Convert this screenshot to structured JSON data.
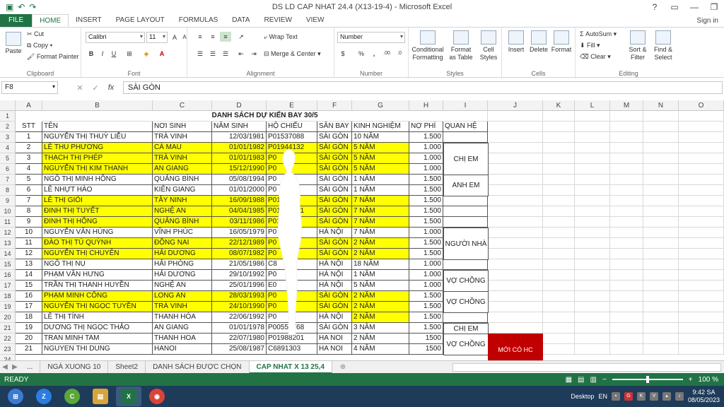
{
  "window": {
    "title": "DS LD CAP NHAT  24.4 (X13-19-4) - Microsoft Excel"
  },
  "ribbon_tabs": [
    "FILE",
    "HOME",
    "INSERT",
    "PAGE LAYOUT",
    "FORMULAS",
    "DATA",
    "REVIEW",
    "VIEW"
  ],
  "signin": "Sign in",
  "clipboard": {
    "paste": "Paste",
    "cut": "Cut",
    "copy": "Copy",
    "format_painter": "Format Painter",
    "label": "Clipboard"
  },
  "font": {
    "name": "Calibri",
    "size": "11",
    "label": "Font"
  },
  "alignment": {
    "wrap": "Wrap Text",
    "merge": "Merge & Center",
    "label": "Alignment"
  },
  "number": {
    "format": "Number",
    "label": "Number"
  },
  "styles": {
    "conditional": "Conditional Formatting",
    "format_table": "Format as Table",
    "cell_styles": "Cell Styles",
    "label": "Styles"
  },
  "cells": {
    "insert": "Insert",
    "delete": "Delete",
    "format": "Format",
    "label": "Cells"
  },
  "editing": {
    "autosum": "AutoSum",
    "fill": "Fill",
    "clear": "Clear",
    "sort": "Sort & Filter",
    "find": "Find & Select",
    "label": "Editing"
  },
  "formula_bar": {
    "name_box": "F8",
    "fx": "fx",
    "value": "SÀI GÒN"
  },
  "columns": [
    "A",
    "B",
    "C",
    "D",
    "E",
    "F",
    "G",
    "H",
    "I",
    "J",
    "K",
    "L",
    "M",
    "N",
    "O"
  ],
  "sheet": {
    "title": "DANH SÁCH DỰ KIẾN BAY 30/5",
    "headers": [
      "STT",
      "TÊN",
      "NƠI SINH",
      "NĂM SINH",
      "HỘ CHIẾU",
      "SÂN BAY",
      "KINH NGHIỆM",
      "NỢ PHÍ",
      "QUAN HỆ"
    ],
    "rows": [
      {
        "n": "3",
        "stt": "1",
        "ten": "NGUYỄN THỊ THUỲ LIỄU",
        "noi": "TRÀ VINH",
        "nam": "12/03/1981",
        "hc": "P01537088",
        "sb": "SÀI GÒN",
        "kn": "10 NĂM",
        "phi": "1.500",
        "y": false
      },
      {
        "n": "4",
        "stt": "2",
        "ten": "LÊ THU PHƯƠNG",
        "noi": "CÀ MAU",
        "nam": "01/01/1982",
        "hc": "P01944132",
        "sb": "SÀI GÒN",
        "kn": "5 NĂM",
        "phi": "1.000",
        "y": true
      },
      {
        "n": "5",
        "stt": "3",
        "ten": "THẠCH THỊ PHÉP",
        "noi": "TRÀ VINH",
        "nam": "01/01/1983",
        "hc": "P0",
        "sb": "SÀI GÒN",
        "kn": "5 NĂM",
        "phi": "1.000",
        "y": true
      },
      {
        "n": "6",
        "stt": "4",
        "ten": "NGUYỄN THỊ KIM THANH",
        "noi": "AN GIANG",
        "nam": "15/12/1990",
        "hc": "P0",
        "sb": "SÀI GÒN",
        "kn": "5 NĂM",
        "phi": "1.000",
        "y": true
      },
      {
        "n": "7",
        "stt": "5",
        "ten": "NGÔ THỊ MINH HỒNG",
        "noi": "QUẢNG BÌNH",
        "nam": "05/08/1994",
        "hc": "P0",
        "sb": "SÀI GÒN",
        "kn": "1 NĂM",
        "phi": "1.500",
        "y": false
      },
      {
        "n": "8",
        "stt": "6",
        "ten": "LÊ NHỰT HÀO",
        "noi": "KIÊN GIANG",
        "nam": "01/01/2000",
        "hc": "P0",
        "sb": "SÀI GÒN",
        "kn": "1 NĂM",
        "phi": "1.500",
        "y": false
      },
      {
        "n": "9",
        "stt": "7",
        "ten": "LÊ THỊ GIỎI",
        "noi": "TÂY NINH",
        "nam": "16/09/1988",
        "hc": "P01",
        "sb": "SÀI GÒN",
        "kn": "7 NĂM",
        "phi": "1.500",
        "y": true
      },
      {
        "n": "10",
        "stt": "8",
        "ten": "ĐINH THỊ TUYẾT",
        "noi": "NGHỆ AN",
        "nam": "04/04/1985",
        "hc": "P01944161",
        "sb": "SÀI GÒN",
        "kn": "7 NĂM",
        "phi": "1.500",
        "y": true
      },
      {
        "n": "11",
        "stt": "9",
        "ten": "ĐINH THỊ HỒNG",
        "noi": "QUẢNG BÌNH",
        "nam": "03/11/1986",
        "hc": "P01",
        "sb": "SÀI GÒN",
        "kn": "7 NĂM",
        "phi": "1.500",
        "y": true
      },
      {
        "n": "12",
        "stt": "10",
        "ten": "NGUYỄN VĂN HÙNG",
        "noi": "VĨNH PHÚC",
        "nam": "16/05/1979",
        "hc": "P0",
        "sb": "HÀ NỘI",
        "kn": "7 NĂM",
        "phi": "1.000",
        "y": false
      },
      {
        "n": "13",
        "stt": "11",
        "ten": "ĐÀO THỊ TÚ QUỲNH",
        "noi": "ĐỒNG NAI",
        "nam": "22/12/1989",
        "hc": "P0",
        "sb": "SÀI GÒN",
        "kn": "2 NĂM",
        "phi": "1.500",
        "y": true
      },
      {
        "n": "14",
        "stt": "12",
        "ten": "NGUYỄN THỊ CHUYÊN",
        "noi": "HẢI DƯƠNG",
        "nam": "08/07/1982",
        "hc": "P0",
        "sb": "SÀI GÒN",
        "kn": "2 NĂM",
        "phi": "1.500",
        "y": true
      },
      {
        "n": "15",
        "stt": "13",
        "ten": "NGÔ THỊ NỤ",
        "noi": "HẢI PHÒNG",
        "nam": "21/05/1986",
        "hc": "C8",
        "sb": "HÀ NỘI",
        "kn": "18 NĂM",
        "phi": "1.000",
        "y": false
      },
      {
        "n": "16",
        "stt": "14",
        "ten": "PHẠM VĂN HƯNG",
        "noi": "HẢI DƯƠNG",
        "nam": "29/10/1992",
        "hc": "P0",
        "sb": "HÀ NỘI",
        "kn": "1 NĂM",
        "phi": "1.000",
        "y": false
      },
      {
        "n": "17",
        "stt": "15",
        "ten": "TRẦN THỊ THANH HUYỀN",
        "noi": "NGHỆ AN",
        "nam": "25/01/1996",
        "hc": "E0",
        "sb": "HÀ NỘI",
        "kn": "5 NĂM",
        "phi": "1.000",
        "y": false
      },
      {
        "n": "18",
        "stt": "16",
        "ten": "PHẠM MINH CÔNG",
        "noi": "LONG AN",
        "nam": "28/03/1993",
        "hc": "P0",
        "sb": "SÀI GÒN",
        "kn": "2 NĂM",
        "phi": "1.500",
        "y": true
      },
      {
        "n": "19",
        "stt": "17",
        "ten": "NGUYỄN THỊ NGỌC TUYỀN",
        "noi": "TRÀ VINH",
        "nam": "24/10/1990",
        "hc": "P0",
        "sb": "SÀI GÒN",
        "kn": "2 NĂM",
        "phi": "1.500",
        "y": true
      },
      {
        "n": "20",
        "stt": "18",
        "ten": "LÊ THỊ TÍNH",
        "noi": "THANH HÓA",
        "nam": "22/06/1992",
        "hc": "P0",
        "sb": "HÀ NỘI",
        "kn": "2 NĂM",
        "phi": "1.500",
        "y": false,
        "ykn": true
      },
      {
        "n": "21",
        "stt": "19",
        "ten": "DƯƠNG THỊ NGỌC THẢO",
        "noi": "AN GIANG",
        "nam": "01/01/1978",
        "hc": "P00557768",
        "sb": "SÀI GÒN",
        "kn": "3 NĂM",
        "phi": "1.500",
        "y": false
      },
      {
        "n": "22",
        "stt": "20",
        "ten": "TRAN MINH TAM",
        "noi": "THANH HOA",
        "nam": "22/07/1980",
        "hc": "P01988201",
        "sb": "HA NOI",
        "kn": "2 NĂM",
        "phi": "1500",
        "y": false
      },
      {
        "n": "23",
        "stt": "21",
        "ten": "NGUYEN THI DUNG",
        "noi": "HANOI",
        "nam": "25/08/1987",
        "hc": "C6891303",
        "sb": "HA NOI",
        "kn": "4 NĂM",
        "phi": "1500",
        "y": false
      }
    ],
    "relations": [
      {
        "label": "CHỊ EM",
        "start": 2,
        "span": 3
      },
      {
        "label": "ANH EM",
        "start": 5,
        "span": 2
      },
      {
        "label": "NGƯỜI NHÀ",
        "start": 10,
        "span": 3
      },
      {
        "label": "VỢ CHỒNG",
        "start": 14,
        "span": 2
      },
      {
        "label": "VỢ CHỒNG",
        "start": 16,
        "span": 2
      },
      {
        "label": "CHỊ EM",
        "start": 19,
        "span": 1
      },
      {
        "label": "VỢ CHỒNG",
        "start": 20,
        "span": 2
      }
    ],
    "note": "MỚI CÓ HC"
  },
  "sheet_tabs": [
    "...",
    "NGÀ XUONG 10",
    "Sheet2",
    "DANH SÁCH ĐƯỢC CHỌN",
    "CAP NHAT X 13 25,4"
  ],
  "status": {
    "ready": "READY",
    "zoom": "100 %"
  },
  "taskbar": {
    "desktop": "Desktop",
    "lang": "EN",
    "time": "9:42 SA",
    "date": "08/05/2023"
  }
}
